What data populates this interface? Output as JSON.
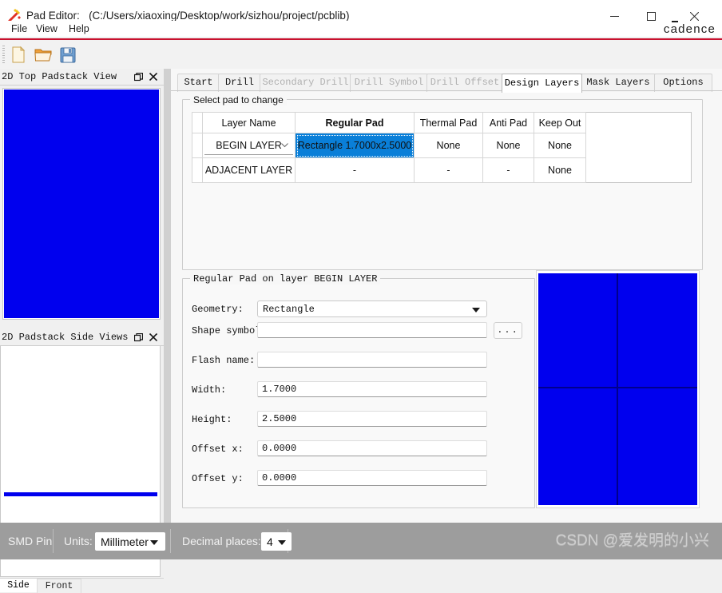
{
  "window": {
    "app_icon": "pad-editor-icon",
    "title": "Pad Editor:",
    "path": "(C:/Users/xiaoxing/Desktop/work/sizhou/project/pcblib)",
    "minimize_label": "—",
    "maximize_label": "□",
    "close_label": "✕",
    "brand": "cadence",
    "brand_accent": "#c8102e"
  },
  "menu": {
    "items": [
      {
        "label": "File"
      },
      {
        "label": "View"
      },
      {
        "label": "Help"
      }
    ]
  },
  "toolbar": {
    "buttons": [
      {
        "name": "new-file-button",
        "icon": "new-document-icon"
      },
      {
        "name": "open-file-button",
        "icon": "open-folder-icon"
      },
      {
        "name": "save-file-button",
        "icon": "floppy-save-icon"
      }
    ]
  },
  "left_dock": {
    "panels": [
      {
        "title": "2D Top Padstack View",
        "float_label": "❐",
        "close_label": "✕"
      },
      {
        "title": "2D Padstack Side Views",
        "float_label": "❐",
        "close_label": "✕"
      }
    ],
    "view_tabs": [
      {
        "label": "Side",
        "active": true
      },
      {
        "label": "Front",
        "active": false
      }
    ],
    "pad_color": "#0000ee"
  },
  "main": {
    "tabs": [
      {
        "label": "Start",
        "state": "normal"
      },
      {
        "label": "Drill",
        "state": "normal"
      },
      {
        "label": "Secondary Drill",
        "state": "disabled"
      },
      {
        "label": "Drill Symbol",
        "state": "disabled"
      },
      {
        "label": "Drill Offset",
        "state": "disabled"
      },
      {
        "label": "Design Layers",
        "state": "active"
      },
      {
        "label": "Mask Layers",
        "state": "normal"
      },
      {
        "label": "Options",
        "state": "normal"
      }
    ],
    "pad_group": {
      "legend": "Select pad to change",
      "table": {
        "headers": [
          "",
          "Layer Name",
          "Regular Pad",
          "Thermal Pad",
          "Anti Pad",
          "Keep Out",
          ""
        ],
        "rows": [
          {
            "row_name": "begin-layer-row",
            "layer_name": "BEGIN LAYER",
            "layer_name_is_combo": true,
            "regular_pad": "Rectangle 1.7000x2.5000",
            "regular_pad_selected": true,
            "thermal_pad": "None",
            "anti_pad": "None",
            "keep_out": "None",
            "trailing": ""
          },
          {
            "row_name": "adjacent-layer-row",
            "layer_name": "ADJACENT LAYER",
            "layer_name_is_combo": false,
            "regular_pad": "-",
            "regular_pad_selected": false,
            "thermal_pad": "-",
            "anti_pad": "-",
            "keep_out": "None",
            "trailing": ""
          }
        ]
      },
      "selection_color": "#0a7fd8"
    },
    "detail_group": {
      "legend": "Regular Pad on layer BEGIN LAYER",
      "fields": [
        {
          "name": "geometry",
          "label": "Geometry:",
          "type": "combo",
          "value": "Rectangle"
        },
        {
          "name": "shape-symbol",
          "label": "Shape symbol:",
          "type": "text",
          "value": "",
          "has_browse": true,
          "browse_label": "..."
        },
        {
          "name": "flash-name",
          "label": "Flash name:",
          "type": "text",
          "value": ""
        },
        {
          "name": "width",
          "label": "Width:",
          "type": "text",
          "value": "1.7000"
        },
        {
          "name": "height",
          "label": "Height:",
          "type": "text",
          "value": "2.5000"
        },
        {
          "name": "offset-x",
          "label": "Offset x:",
          "type": "text",
          "value": "0.0000"
        },
        {
          "name": "offset-y",
          "label": "Offset y:",
          "type": "text",
          "value": "0.0000"
        }
      ]
    },
    "preview": {
      "pad_color": "#0000ee",
      "crosshair_color": "#00008b"
    }
  },
  "status_bar": {
    "pin_type": "SMD Pin",
    "units_label": "Units:",
    "units_value": "Millimeter",
    "decimal_label": "Decimal places:",
    "decimal_value": "4",
    "watermark": "CSDN @爱发明的小兴"
  }
}
